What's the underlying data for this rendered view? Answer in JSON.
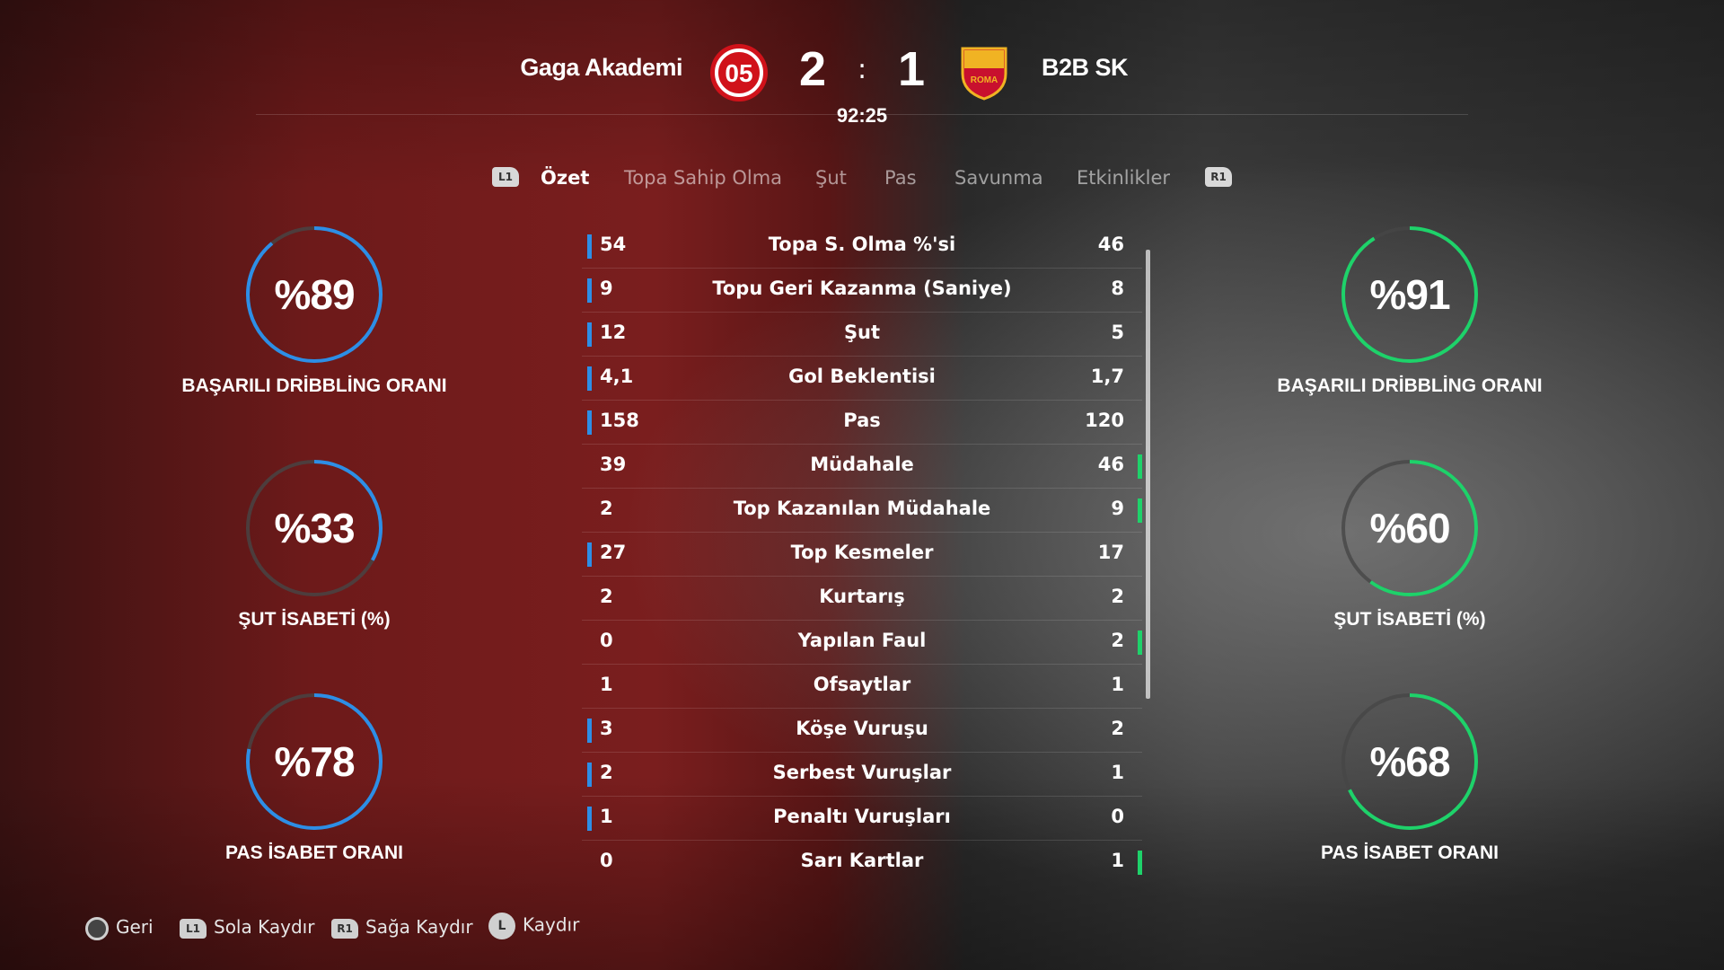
{
  "header": {
    "home_team": "Gaga Akademi",
    "away_team": "B2B SK",
    "home_score": "2",
    "away_score": "1",
    "separator": ":",
    "clock": "92:25",
    "home_crest_text": "05",
    "away_crest_text": "ROMA"
  },
  "tabs": {
    "left_bumper": "L1",
    "right_bumper": "R1",
    "items": [
      "Özet",
      "Topa Sahip Olma",
      "Şut",
      "Pas",
      "Savunma",
      "Etkinlikler"
    ],
    "active": "Özet"
  },
  "rings": {
    "home": [
      {
        "value": "%89",
        "label": "BAŞARILI DRİBBLİNG ORANI",
        "percent": 89
      },
      {
        "value": "%33",
        "label": "ŞUT İSABETİ (%)",
        "percent": 33
      },
      {
        "value": "%78",
        "label": "PAS İSABET ORANI",
        "percent": 78
      }
    ],
    "away": [
      {
        "value": "%91",
        "label": "BAŞARILI DRİBBLİNG ORANI",
        "percent": 91
      },
      {
        "value": "%60",
        "label": "ŞUT İSABETİ (%)",
        "percent": 60
      },
      {
        "value": "%68",
        "label": "PAS İSABET ORANI",
        "percent": 68
      }
    ],
    "home_color": "#2d8ee6",
    "away_color": "#1ed26a"
  },
  "stats": [
    {
      "home": "54",
      "label": "Topa S. Olma %'si",
      "away": "46",
      "leader": "home"
    },
    {
      "home": "9",
      "label": "Topu Geri Kazanma (Saniye)",
      "away": "8",
      "leader": "home"
    },
    {
      "home": "12",
      "label": "Şut",
      "away": "5",
      "leader": "home"
    },
    {
      "home": "4,1",
      "label": "Gol Beklentisi",
      "away": "1,7",
      "leader": "home"
    },
    {
      "home": "158",
      "label": "Pas",
      "away": "120",
      "leader": "home"
    },
    {
      "home": "39",
      "label": "Müdahale",
      "away": "46",
      "leader": "away"
    },
    {
      "home": "2",
      "label": "Top Kazanılan Müdahale",
      "away": "9",
      "leader": "away"
    },
    {
      "home": "27",
      "label": "Top Kesmeler",
      "away": "17",
      "leader": "home"
    },
    {
      "home": "2",
      "label": "Kurtarış",
      "away": "2",
      "leader": "none"
    },
    {
      "home": "0",
      "label": "Yapılan Faul",
      "away": "2",
      "leader": "away"
    },
    {
      "home": "1",
      "label": "Ofsaytlar",
      "away": "1",
      "leader": "none"
    },
    {
      "home": "3",
      "label": "Köşe Vuruşu",
      "away": "2",
      "leader": "home"
    },
    {
      "home": "2",
      "label": "Serbest Vuruşlar",
      "away": "1",
      "leader": "home"
    },
    {
      "home": "1",
      "label": "Penaltı Vuruşları",
      "away": "0",
      "leader": "home"
    },
    {
      "home": "0",
      "label": "Sarı Kartlar",
      "away": "1",
      "leader": "away"
    }
  ],
  "footer": {
    "back": {
      "glyph": "circle-button",
      "label": "Geri"
    },
    "scroll_left": {
      "glyph": "L1",
      "label": "Sola Kaydır"
    },
    "scroll_right": {
      "glyph": "R1",
      "label": "Sağa Kaydır"
    },
    "scroll": {
      "glyph": "L",
      "label": "Kaydır"
    }
  }
}
